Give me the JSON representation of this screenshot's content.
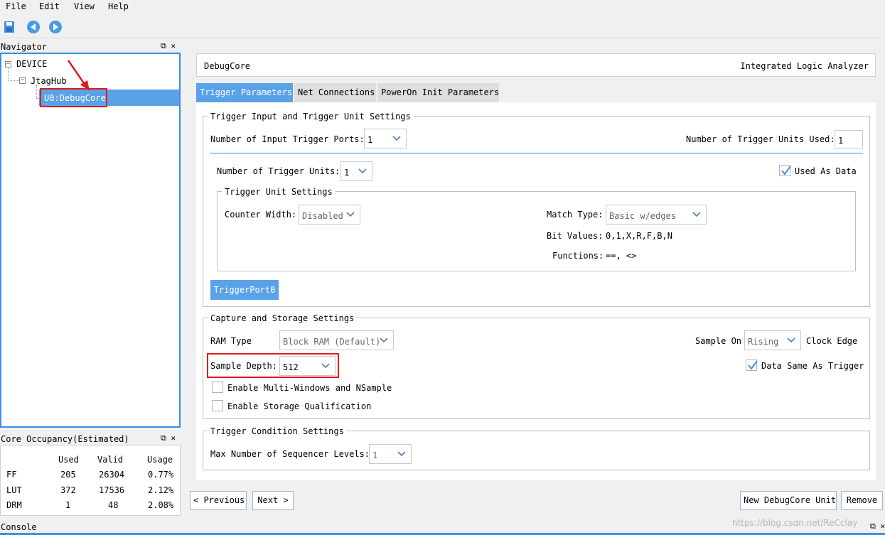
{
  "menu": [
    "File",
    "Edit",
    "View",
    "Help"
  ],
  "toolbar": {
    "icons": [
      "save-icon",
      "back-icon",
      "forward-icon"
    ],
    "accent": "#3c8fe0"
  },
  "navigator": {
    "title": "Navigator",
    "pane_controls": "⧉ ✕",
    "tree": {
      "root": "DEVICE",
      "child": "JtagHub",
      "leaf": "U0:DebugCore"
    }
  },
  "occupancy": {
    "title": "Core Occupancy(Estimated)",
    "pane_controls": "⧉ ✕",
    "columns": [
      "Used",
      "Valid",
      "Usage"
    ],
    "rows": [
      {
        "name": "FF",
        "used": "205",
        "valid": "26304",
        "usage": "0.77%"
      },
      {
        "name": "LUT",
        "used": "372",
        "valid": "17536",
        "usage": "2.12%"
      },
      {
        "name": "DRM",
        "used": "1",
        "valid": "48",
        "usage": "2.08%"
      }
    ]
  },
  "console": {
    "title": "Console",
    "pane_controls": "⧉ ✕"
  },
  "header": {
    "left": "DebugCore",
    "right": "Integrated Logic Analyzer"
  },
  "tabs": [
    "Trigger Parameters",
    "Net Connections",
    "PowerOn Init Parameters"
  ],
  "trigger_input": {
    "title": "Trigger Input and Trigger Unit Settings",
    "ports_label": "Number of Input Trigger Ports:",
    "ports_value": "1",
    "units_used_label": "Number of Trigger Units Used:",
    "units_used_value": "1",
    "units_label": "Number of Trigger Units:",
    "units_value": "1",
    "used_as_data_label": "Used As Data",
    "used_as_data_checked": true,
    "unit_settings": {
      "title": "Trigger Unit Settings",
      "counter_label": "Counter Width:",
      "counter_value": "Disabled",
      "match_label": "Match Type:",
      "match_value": "Basic w/edges",
      "bits_label": "Bit Values:",
      "bits_value": "0,1,X,R,F,B,N",
      "functions_label": "Functions:",
      "functions_value": "==, <>"
    },
    "port_button": "TriggerPort0"
  },
  "capture": {
    "title": "Capture and Storage Settings",
    "ram_label": "RAM Type",
    "ram_value": "Block RAM (Default)",
    "sample_on_label": "Sample On",
    "sample_on_value": "Rising",
    "clock_edge_label": "Clock Edge",
    "depth_label": "Sample Depth:",
    "depth_value": "512",
    "data_same_label": "Data Same As Trigger",
    "data_same_checked": true,
    "multi_windows_label": "Enable Multi-Windows and NSample",
    "storage_qual_label": "Enable Storage Qualification"
  },
  "trigger_condition": {
    "title": "Trigger Condition Settings",
    "levels_label": "Max Number of Sequencer Levels:",
    "levels_value": "1"
  },
  "buttons": {
    "previous": "< Previous",
    "next": "Next >",
    "new_unit": "New DebugCore Unit",
    "remove": "Remove"
  },
  "watermark": "https://blog.csdn.net/ReCclay",
  "colors": {
    "selection": "#5aa2e8",
    "highlight_box": "#e21b1b",
    "arrow": "#e21b1b"
  }
}
